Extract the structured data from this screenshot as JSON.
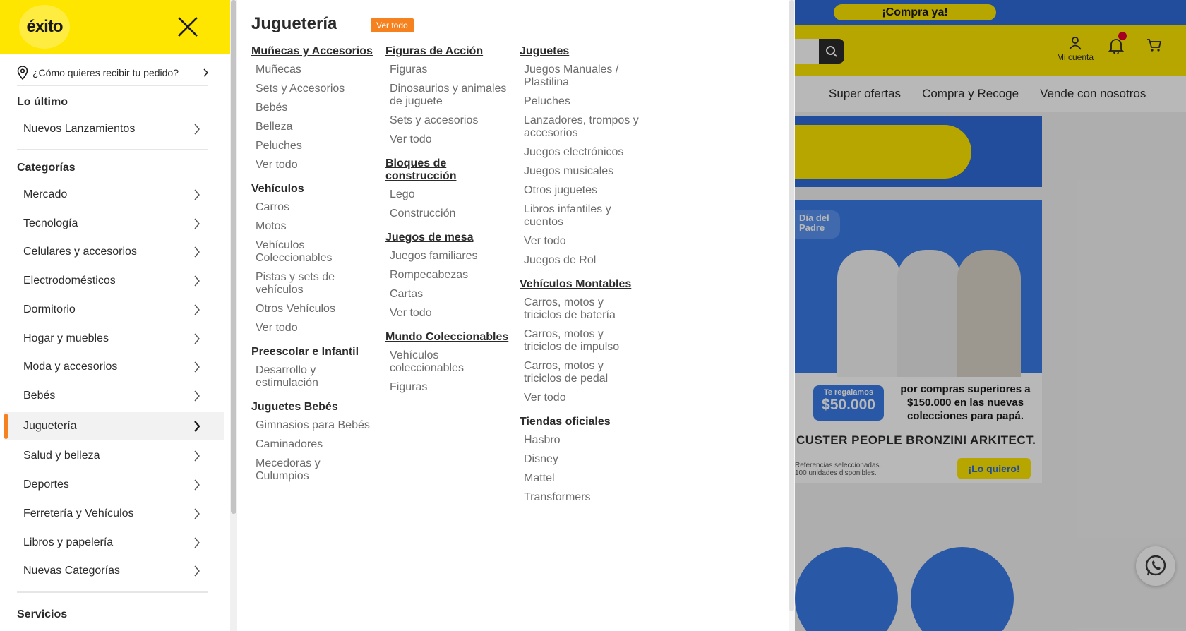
{
  "site": {
    "promo": "¡Compra ya!",
    "account_label": "Mi cuenta",
    "nav_links": [
      "Super ofertas",
      "Compra y Recoge",
      "Vende con nosotros"
    ],
    "banner": {
      "badge": "Día del Padre",
      "gift_small": "Te regalamos",
      "gift_amount": "$50.000",
      "headline": "por compras superiores a $150.000 en las nuevas colecciones para papá.",
      "brands": "CUSTER  PEOPLE  BRONZINI  ARKITECT.",
      "footnote_1": "Referencias seleccionadas.",
      "footnote_2": "100 unidades disponibles.",
      "cta": "¡Lo quiero!"
    },
    "colors": {
      "brand_yellow": "#ffe600",
      "brand_blue": "#2f6bd9",
      "accent_orange": "#f5821f"
    }
  },
  "drawer": {
    "logo": "éxito",
    "delivery_prompt": "¿Cómo quieres recibir tu pedido?",
    "latest_title": "Lo último",
    "latest_items": [
      "Nuevos Lanzamientos"
    ],
    "categories_title": "Categorías",
    "categories": [
      "Mercado",
      "Tecnología",
      "Celulares y accesorios",
      "Electrodomésticos",
      "Dormitorio",
      "Hogar y muebles",
      "Moda y accesorios",
      "Bebés",
      "Juguetería",
      "Salud y belleza",
      "Deportes",
      "Ferretería y Vehículos",
      "Libros y papelería",
      "Nuevas Categorías"
    ],
    "active_category": "Juguetería",
    "services_title": "Servicios"
  },
  "panel": {
    "title": "Juguetería",
    "view_all": "Ver todo",
    "columns": [
      [
        {
          "title": "Muñecas y Accesorios",
          "items": [
            "Muñecas",
            "Sets y Accesorios",
            "Bebés",
            "Belleza",
            "Peluches",
            "Ver todo"
          ]
        },
        {
          "title": "Vehículos",
          "items": [
            "Carros",
            "Motos",
            "Vehículos Coleccionables",
            "Pistas y sets de vehículos",
            "Otros Vehículos",
            "Ver todo"
          ]
        },
        {
          "title": "Preescolar e Infantil",
          "items": [
            "Desarrollo y estimulación"
          ]
        },
        {
          "title": "Juguetes Bebés",
          "items": [
            "Gimnasios para Bebés",
            "Caminadores",
            "Mecedoras y Culumpios"
          ]
        }
      ],
      [
        {
          "title": "Figuras de Acción",
          "items": [
            "Figuras",
            "Dinosaurios y animales de juguete",
            "Sets y accesorios",
            "Ver todo"
          ]
        },
        {
          "title": "Bloques de construcción",
          "items": [
            "Lego",
            "Construcción"
          ]
        },
        {
          "title": "Juegos de mesa",
          "items": [
            "Juegos familiares",
            "Rompecabezas",
            "Cartas",
            "Ver todo"
          ]
        },
        {
          "title": "Mundo Coleccionables",
          "items": [
            "Vehículos coleccionables",
            "Figuras"
          ]
        }
      ],
      [
        {
          "title": "Juguetes",
          "items": [
            "Juegos Manuales / Plastilina",
            "Peluches",
            "Lanzadores, trompos y accesorios",
            "Juegos electrónicos",
            "Juegos musicales",
            "Otros juguetes",
            "Libros infantiles y cuentos",
            "Ver todo",
            "Juegos de Rol"
          ]
        },
        {
          "title": "Vehículos Montables",
          "items": [
            "Carros, motos y triciclos de batería",
            "Carros, motos y triciclos de impulso",
            "Carros, motos y triciclos de pedal",
            "Ver todo"
          ]
        },
        {
          "title": "Tiendas oficiales",
          "items": [
            "Hasbro",
            "Disney",
            "Mattel",
            "Transformers"
          ]
        }
      ]
    ]
  }
}
